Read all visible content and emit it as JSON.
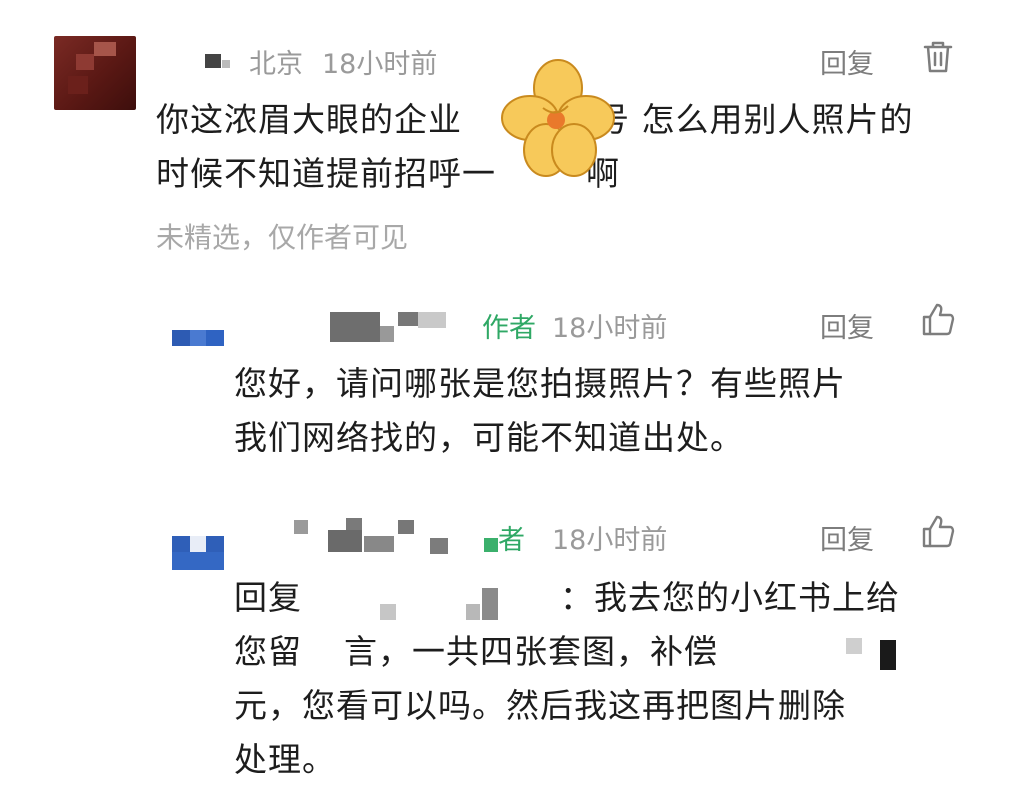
{
  "comments": [
    {
      "location": "北京",
      "time": "18小时前",
      "reply_label": "回复",
      "text_line1": "你这浓眉大眼的企业",
      "text_line1_tail": "号 怎么用别人照片的",
      "text_line2": "时候不知道提前招呼一",
      "text_line2_tail": "啊",
      "visibility_note": "未精选，仅作者可见"
    },
    {
      "author_tag": "作者",
      "time": "18小时前",
      "reply_label": "回复",
      "text_line1": "您好，请问哪张是您拍摄照片？有些照片",
      "text_line2": "我们网络找的，可能不知道出处。"
    },
    {
      "author_tag": "者",
      "time": "18小时前",
      "reply_label": "回复",
      "text_line1_head": "回复",
      "text_line1_tail": "：我去您的小红书上给",
      "text_line2_head": "您留",
      "text_line2_mid": "言，一共四张套图，补偿",
      "text_line3": "元，您看可以吗。然后我这再把图片删除",
      "text_line4": "处理。"
    }
  ],
  "icons": {
    "delete": "trash-icon",
    "like": "thumbs-up-icon"
  }
}
